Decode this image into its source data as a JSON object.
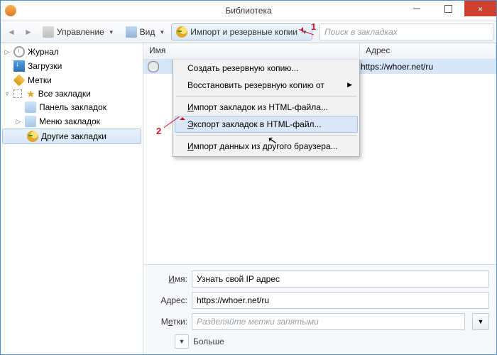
{
  "window": {
    "title": "Библиотека"
  },
  "toolbar": {
    "manage": "Управление",
    "view": "Вид",
    "import": "Импорт и резервные копии"
  },
  "search": {
    "placeholder": "Поиск в закладках"
  },
  "sidebar": {
    "history": "Журнал",
    "downloads": "Загрузки",
    "tags": "Метки",
    "all_bm": "Все закладки",
    "toolbar_bm": "Панель закладок",
    "menu_bm": "Меню закладок",
    "other_bm": "Другие закладки"
  },
  "columns": {
    "name": "Имя",
    "addr": "Адрес"
  },
  "rows": [
    {
      "name": "",
      "addr": "https://whoer.net/ru"
    }
  ],
  "menu": {
    "backup": "Создать резервную копию...",
    "restore": "Восстановить резервную копию от",
    "import_html_pre": "И",
    "import_html_post": "мпорт закладок из HTML-файла...",
    "export_html_pre": "Э",
    "export_html_post": "кспорт закладок в HTML-файл...",
    "import_other_pre": "И",
    "import_other_post": "мпорт данных из другого браузера..."
  },
  "details": {
    "name_lbl": "Имя:",
    "addr_lbl": "Адрес:",
    "tags_lbl": "Метки:",
    "name_val": "Узнать свой IP адрес",
    "addr_val": "https://whoer.net/ru",
    "tags_ph": "Разделяйте метки запятыми",
    "more": "Больше"
  },
  "ann": {
    "one": "1",
    "two": "2"
  }
}
